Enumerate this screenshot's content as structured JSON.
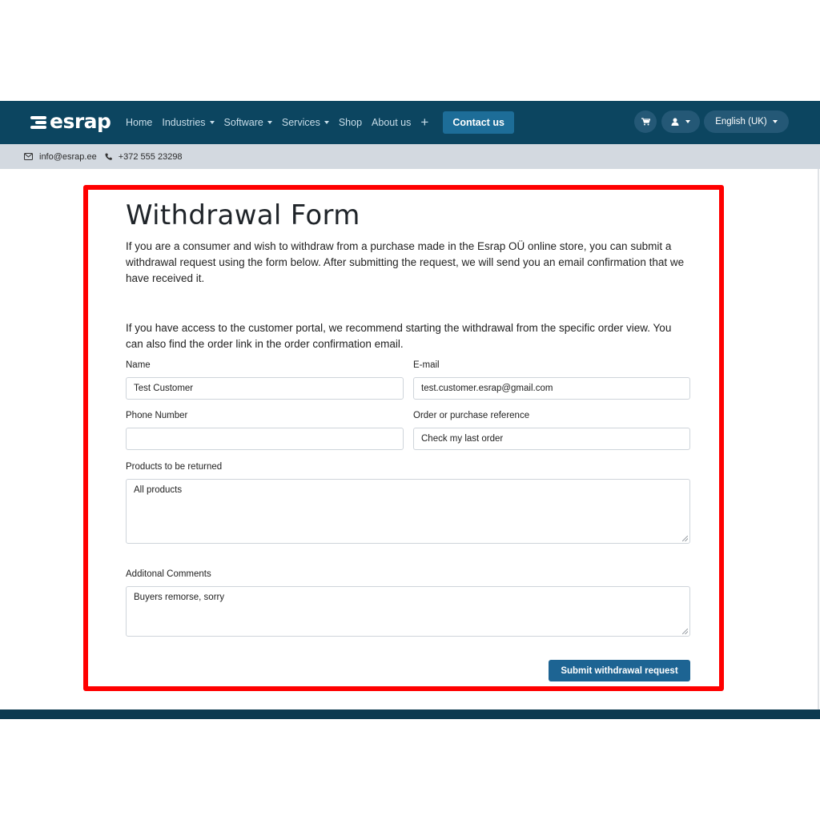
{
  "brand": {
    "name": "esrap"
  },
  "nav": {
    "items": [
      {
        "label": "Home",
        "dropdown": false
      },
      {
        "label": "Industries",
        "dropdown": true
      },
      {
        "label": "Software",
        "dropdown": true
      },
      {
        "label": "Services",
        "dropdown": true
      },
      {
        "label": "Shop",
        "dropdown": false
      },
      {
        "label": "About us",
        "dropdown": false
      }
    ],
    "plus": "+",
    "contact_label": "Contact us",
    "language": "English (UK)"
  },
  "contact_strip": {
    "email": "info@esrap.ee",
    "phone": "+372 555 23298"
  },
  "form": {
    "title": "Withdrawal Form",
    "intro": "If you are a consumer and wish to withdraw from a purchase made in the Esrap OÜ online store, you can submit a withdrawal request using the form below. After submitting the request, we will send you an email confirmation that we have received it.",
    "portal_note": "If you have access to the customer portal, we recommend starting the withdrawal from the specific order view. You can also find the order link in the order confirmation email.",
    "name": {
      "label": "Name",
      "value": "Test Customer"
    },
    "email": {
      "label": "E-mail",
      "value": "test.customer.esrap@gmail.com"
    },
    "phone": {
      "label": "Phone Number",
      "value": ""
    },
    "order_ref": {
      "label": "Order or purchase reference",
      "value": "Check my last order"
    },
    "products": {
      "label": "Products to be returned",
      "value": "All products"
    },
    "comments": {
      "label": "Additonal Comments",
      "value": "Buyers remorse, sorry"
    },
    "submit_label": "Submit withdrawal request"
  },
  "colors": {
    "navbar": "#0c4560",
    "accent": "#1d6d98",
    "highlight": "#ff0000",
    "contact_strip": "#d3d9e0"
  }
}
